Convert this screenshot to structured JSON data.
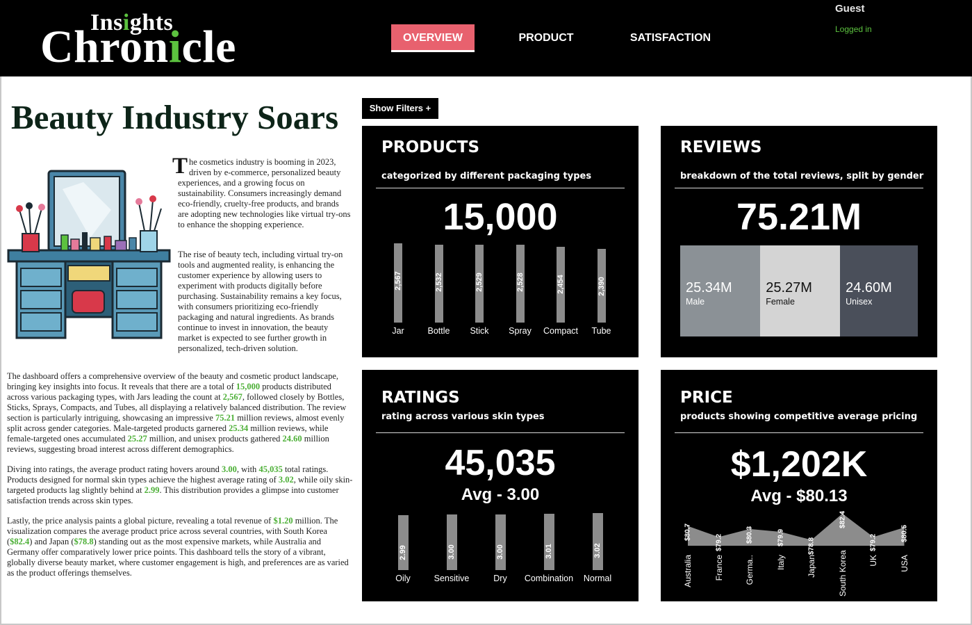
{
  "brand": {
    "top": "Insights",
    "bottom": "Chronicle"
  },
  "nav": {
    "overview": "OVERVIEW",
    "product": "PRODUCT",
    "satisfaction": "SATISFACTION"
  },
  "user": {
    "name": "Guest",
    "status": "Logged in"
  },
  "colors": {
    "accent_green": "#5cc23f",
    "active_tab": "#e8616e",
    "card_bg": "#000000"
  },
  "article": {
    "headline": "Beauty Industry Soars",
    "dropcap": "T",
    "p1": "he cosmetics industry is booming in 2023, driven by e-commerce, personalized beauty experiences, and a growing focus on sustainability. Consumers increasingly demand eco-friendly, cruelty-free products, and brands are adopting new technologies like virtual try-ons to enhance the shopping experience.",
    "p2": "The rise of beauty tech, including virtual try-on tools and augmented reality, is enhancing the customer experience by allowing users to experiment with products digitally before purchasing. Sustainability remains a key focus, with consumers prioritizing eco-friendly packaging and natural ingredients. As brands continue to invest in innovation, the beauty market is expected to see further growth in personalized, tech-driven solution.",
    "p3": [
      {
        "t": "The dashboard offers a comprehensive overview of the beauty and cosmetic product landscape, bringing key insights into focus. It reveals that there are a total of "
      },
      {
        "t": "15,000",
        "h": true
      },
      {
        "t": " products distributed across various packaging types, with Jars leading the count at "
      },
      {
        "t": "2,567",
        "h": true
      },
      {
        "t": ", followed closely by Bottles, Sticks, Sprays, Compacts, and Tubes, all displaying a relatively balanced distribution. The review section is particularly intriguing, showcasing an impressive "
      },
      {
        "t": "75.21",
        "h": true
      },
      {
        "t": " million reviews, almost evenly split across gender categories. Male-targeted products garnered "
      },
      {
        "t": "25.34",
        "h": true
      },
      {
        "t": " million reviews, while female-targeted ones accumulated "
      },
      {
        "t": "25.27",
        "h": true
      },
      {
        "t": " million, and unisex products gathered "
      },
      {
        "t": "24.60",
        "h": true
      },
      {
        "t": " million reviews, suggesting broad interest across different demographics."
      }
    ],
    "p4": [
      {
        "t": "Diving into ratings, the average product rating hovers around "
      },
      {
        "t": "3.00",
        "h": true
      },
      {
        "t": ", with "
      },
      {
        "t": "45,035",
        "h": true
      },
      {
        "t": " total ratings. Products designed for normal skin types achieve the highest average rating of "
      },
      {
        "t": "3.02",
        "h": true
      },
      {
        "t": ", while oily skin-targeted products lag slightly behind at "
      },
      {
        "t": "2.99",
        "h": true
      },
      {
        "t": ". This distribution provides a glimpse into customer satisfaction trends across skin types."
      }
    ],
    "p5": [
      {
        "t": "Lastly, the price analysis paints a global picture, revealing a total revenue of "
      },
      {
        "t": "$1.20",
        "h": true
      },
      {
        "t": " million. The visualization compares the average product price across several countries, with South Korea ("
      },
      {
        "t": "$82.4",
        "h": true
      },
      {
        "t": ") and Japan ("
      },
      {
        "t": "$78.8",
        "h": true
      },
      {
        "t": ") standing out as the most expensive markets, while Australia and Germany offer comparatively lower price points. This dashboard tells the story of a vibrant, globally diverse beauty market, where customer engagement is high, and preferences are as varied as the product offerings themselves."
      }
    ]
  },
  "filters": {
    "label": "Show Filters +"
  },
  "products": {
    "title": "PRODUCTS",
    "subtitle": "categorized by different packaging types",
    "total": "15,000"
  },
  "reviews": {
    "title": "REVIEWS",
    "subtitle": "breakdown of the total reviews, split by gender",
    "total": "75.21M",
    "segments": [
      {
        "value": "25.34M",
        "label": "Male",
        "color": "#8b9196",
        "text_color": "#ffffff",
        "share": 25.34
      },
      {
        "value": "25.27M",
        "label": "Female",
        "color": "#d4d4d4",
        "text_color": "#111111",
        "share": 25.27
      },
      {
        "value": "24.60M",
        "label": "Unisex",
        "color": "#4a4f5a",
        "text_color": "#ffffff",
        "share": 24.6
      }
    ]
  },
  "ratings": {
    "title": "RATINGS",
    "subtitle": "rating across various skin types",
    "total": "45,035",
    "avg": "Avg - 3.00"
  },
  "price": {
    "title": "PRICE",
    "subtitle": "products showing competitive average pricing",
    "total": "$1,202K",
    "avg": "Avg - $80.13"
  },
  "chart_data": [
    {
      "type": "bar",
      "title": "PRODUCTS",
      "categories": [
        "Jar",
        "Bottle",
        "Stick",
        "Spray",
        "Compact",
        "Tube"
      ],
      "values": [
        2567,
        2532,
        2529,
        2528,
        2454,
        2390
      ],
      "labels": [
        "2,567",
        "2,532",
        "2,529",
        "2,528",
        "2,454",
        "2,390"
      ]
    },
    {
      "type": "bar",
      "title": "RATINGS",
      "categories": [
        "Oily",
        "Sensitive",
        "Dry",
        "Combination",
        "Normal"
      ],
      "values": [
        2.99,
        3.0,
        3.0,
        3.01,
        3.02
      ],
      "labels": [
        "2.99",
        "3.00",
        "3.00",
        "3.01",
        "3.02"
      ]
    },
    {
      "type": "area",
      "title": "PRICE",
      "categories": [
        "Australia",
        "France",
        "Germa..",
        "Italy",
        "Japan",
        "South Korea",
        "UK",
        "USA"
      ],
      "values": [
        80.7,
        79.2,
        80.3,
        79.9,
        78.8,
        82.4,
        79.2,
        80.5
      ],
      "labels": [
        "$80.7",
        "$79.2",
        "$80.3",
        "$79.9",
        "$78.8",
        "$82.4",
        "$79.2",
        "$80.5"
      ]
    }
  ]
}
